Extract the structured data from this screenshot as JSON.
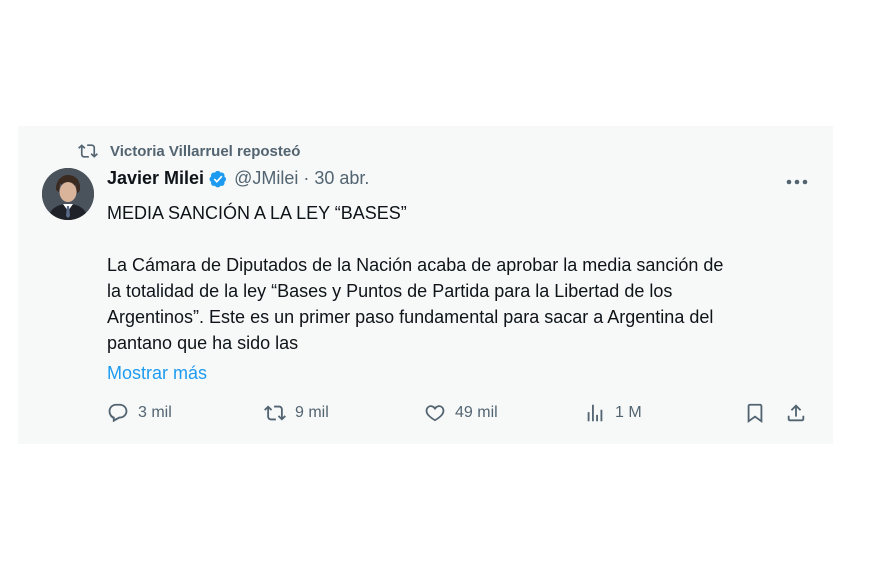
{
  "repost": {
    "label": "Victoria Villarruel reposteó",
    "icon": "repost-icon"
  },
  "author": {
    "name": "Javier Milei",
    "verified_icon": "verified-badge-icon",
    "handle": "@JMilei",
    "separator": "·",
    "date": "30 abr."
  },
  "post": {
    "headline": "MEDIA SANCIÓN A LA LEY “BASES”",
    "lines": [
      "La Cámara de Diputados de la Nación acaba de aprobar la media sanción de",
      "la totalidad de la ley “Bases y Puntos de Partida para la Libertad de los",
      "Argentinos”. Este es un primer paso fundamental para sacar a Argentina del",
      "pantano que ha sido las"
    ],
    "show_more": "Mostrar más"
  },
  "actions": {
    "replies": "3 mil",
    "reposts": "9 mil",
    "likes": "49 mil",
    "views": "1 M"
  },
  "colors": {
    "accent": "#1d9bf0",
    "muted": "#536471",
    "card_bg": "#f7f9f9"
  }
}
